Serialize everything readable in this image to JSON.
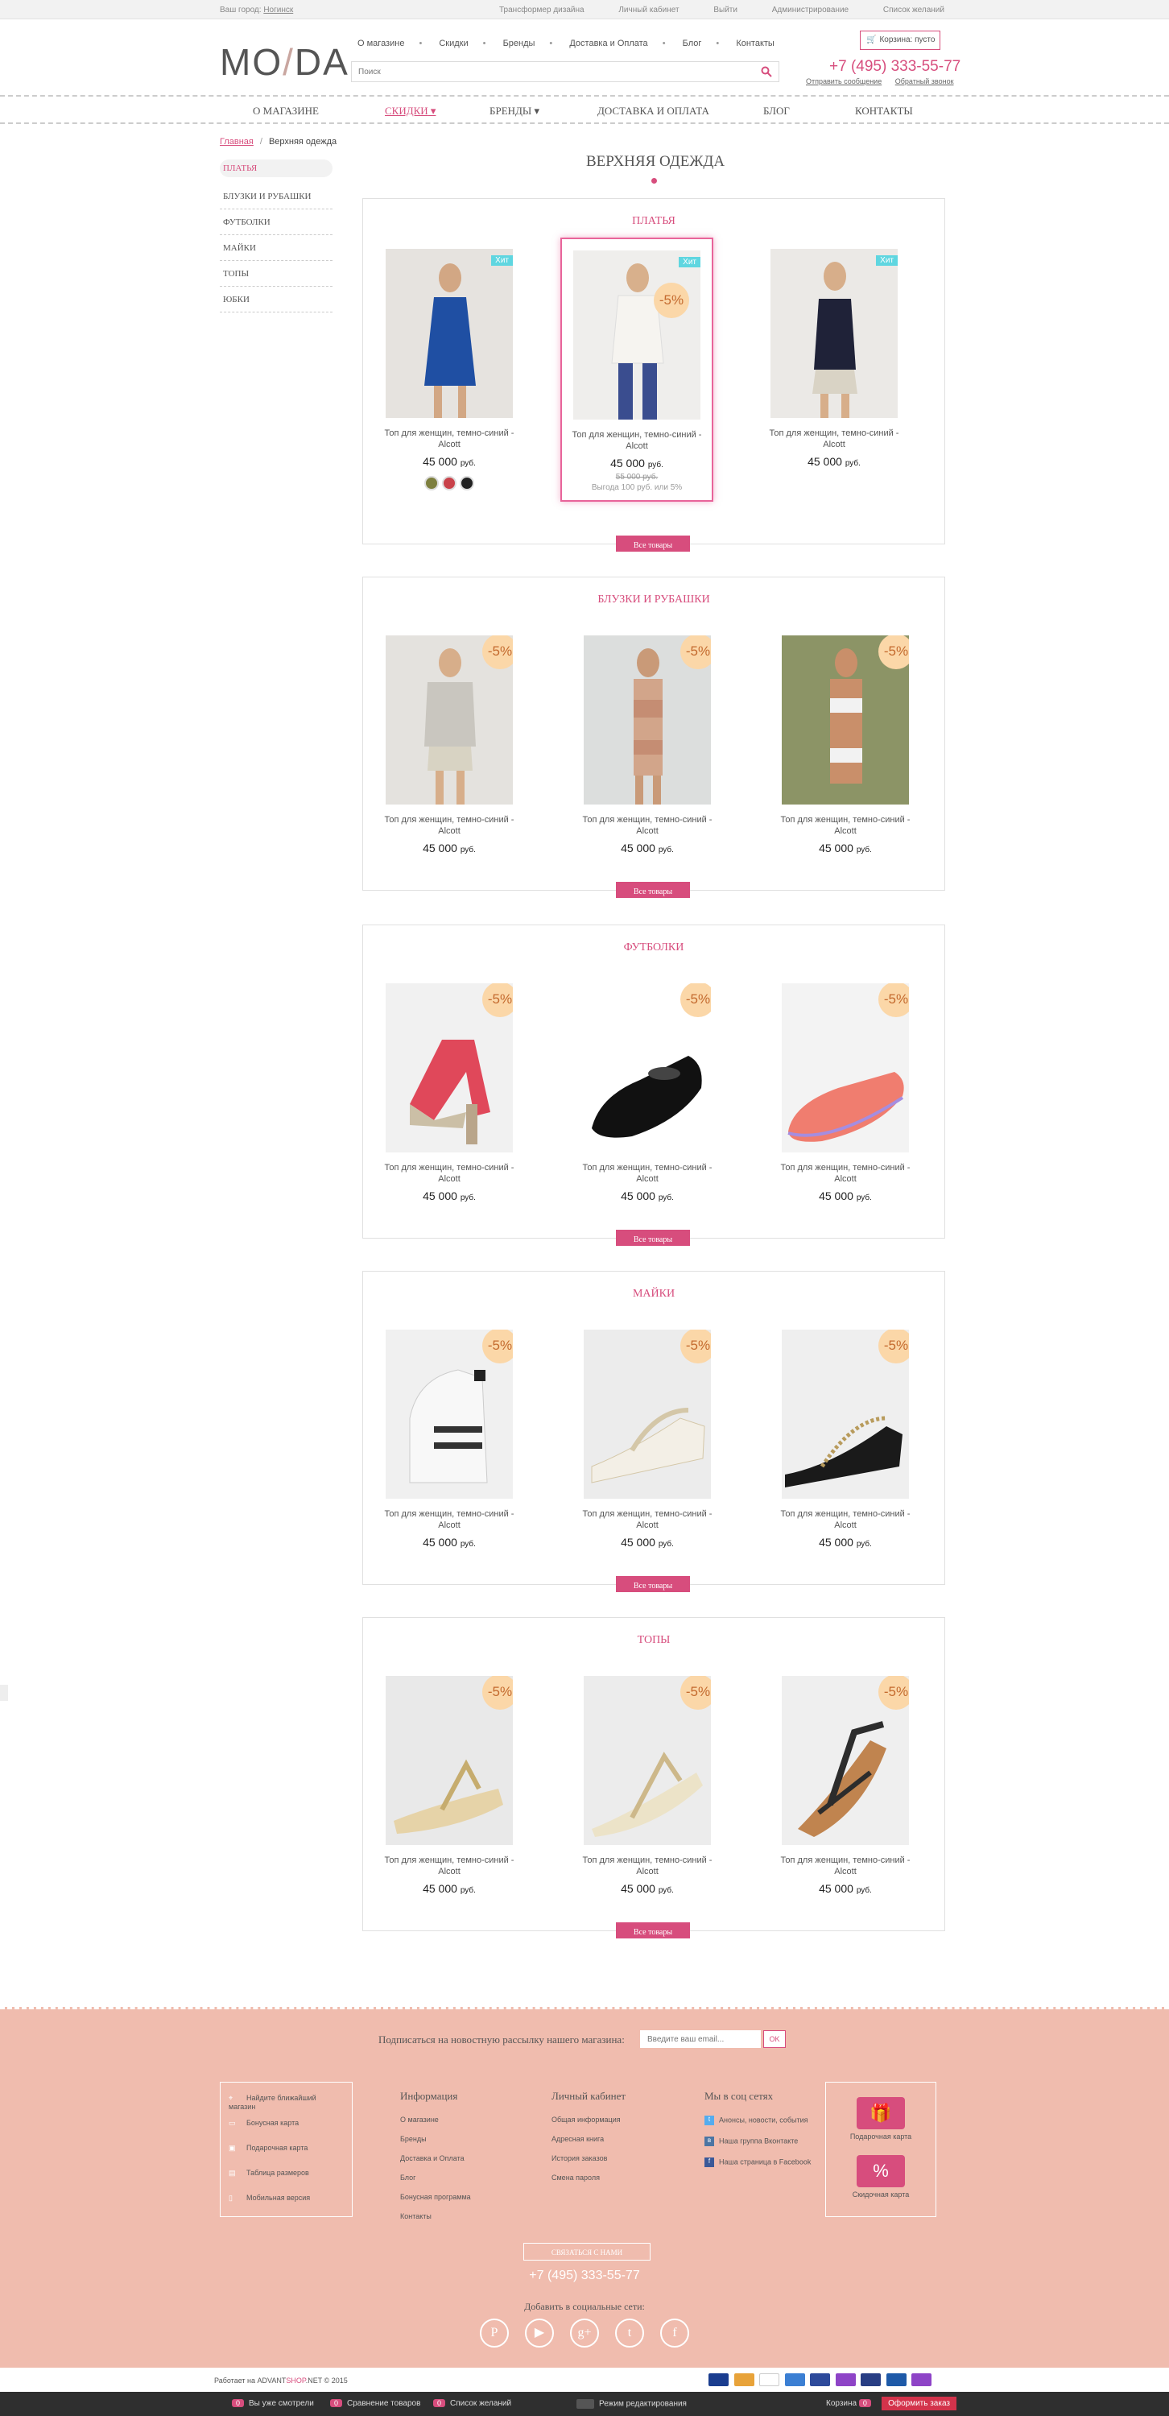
{
  "topbar": {
    "city_label": "Ваш город:",
    "city_value": "Ногинск",
    "links": [
      "Трансформер дизайна",
      "Личный кабинет",
      "Выйти",
      "Администрирование",
      "Список желаний"
    ]
  },
  "header": {
    "logo_left": "MO",
    "logo_right": "DA",
    "menu": [
      "О магазине",
      "Скидки",
      "Бренды",
      "Доставка и Оплата",
      "Блог",
      "Контакты"
    ],
    "search_placeholder": "Поиск",
    "cart_label": "Корзина: пусто",
    "phone": "+7 (495) 333-55-77",
    "phone_links": [
      "Отправить сообщение",
      "Обратный звонок"
    ]
  },
  "mainnav": [
    "О МАГАЗИНЕ",
    "СКИДКИ",
    "БРЕНДЫ",
    "ДОСТАВКА И ОПЛАТА",
    "БЛОГ",
    "КОНТАКТЫ"
  ],
  "breadcrumb": {
    "home": "Главная",
    "current": "Верхняя одежда"
  },
  "sidebar": [
    "ПЛАТЬЯ",
    "БЛУЗКИ И РУБАШКИ",
    "ФУТБОЛКИ",
    "МАЙКИ",
    "ТОПЫ",
    "ЮБКИ"
  ],
  "page_title": "ВЕРХНЯЯ ОДЕЖДА",
  "all_button": "Все товары",
  "product_name": "Топ для женщин, темно-синий - Alcott",
  "price": "45 000",
  "currency": "руб.",
  "badge_hit": "Хит",
  "badge_sale": "-5%",
  "old_price": "55 000 руб.",
  "savings": "Выгода 100 руб. или 5%",
  "swatch_colors": [
    "#7d7f3e",
    "#c9424a",
    "#222222"
  ],
  "categories": [
    "ПЛАТЬЯ",
    "БЛУЗКИ И РУБАШКИ",
    "ФУТБОЛКИ",
    "МАЙКИ",
    "ТОПЫ"
  ],
  "footer": {
    "subscribe_text": "Подписаться на новостную рассылку нашего магазина:",
    "subscribe_placeholder": "Введите ваш email...",
    "subscribe_ok": "OK",
    "box1": [
      "Найдите ближайший магазин",
      "Бонусная карта",
      "Подарочная карта",
      "Таблица размеров",
      "Мобильная версия"
    ],
    "info_head": "Информация",
    "info": [
      "О магазине",
      "Бренды",
      "Доставка и Оплата",
      "Блог",
      "Бонусная программа",
      "Контакты"
    ],
    "account_head": "Личный кабинет",
    "account": [
      "Общая информация",
      "Адресная книга",
      "История заказов",
      "Смена пароля"
    ],
    "social_head": "Мы в соц сетях",
    "social": [
      "Анонсы, новости, события",
      "Наша группа Вконтакте",
      "Наша страница в Facebook"
    ],
    "gift_label": "Подарочная карта",
    "discount_label": "Скидочная карта",
    "contact_btn": "СВЯЗАТЬСЯ С НАМИ",
    "phone": "+7 (495) 333-55-77",
    "add_social": "Добавить в социальные сети:"
  },
  "copyright": {
    "pre": "Работает на ",
    "brand_a": "ADVANT",
    "brand_b": "SHOP",
    "post": ".NET © 2015"
  },
  "bottombar": {
    "viewed_count": "0",
    "viewed": "Вы уже смотрели",
    "compare_count": "0",
    "compare": "Сравнение товаров",
    "wish_count": "0",
    "wish": "Список желаний",
    "edit_mode": "Режим редактирования",
    "cart": "Корзина",
    "cart_count": "0",
    "order": "Оформить заказ"
  },
  "colors": {
    "accent": "#d74d7d",
    "footer_bg": "#f0bcae",
    "sale_badge": "#fbd7a8",
    "hit_badge": "#5fd6e0"
  }
}
